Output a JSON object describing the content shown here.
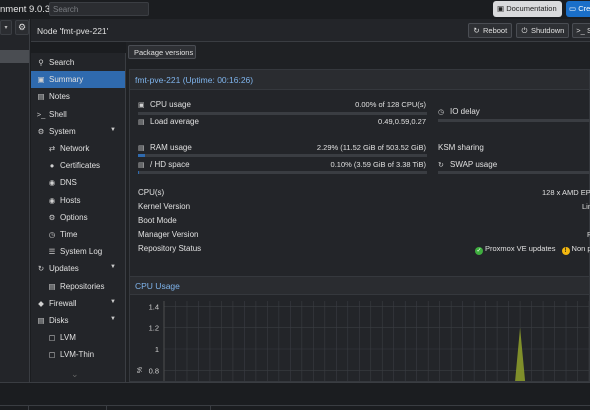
{
  "topbar": {
    "title_fragment": "nment 9.0.3",
    "search_placeholder": "Search",
    "documentation_label": "Documentation",
    "create_label": "Cre"
  },
  "tree": {
    "view_selector_icon": "chevron-down-icon",
    "gear_icon": "gear-icon"
  },
  "node_bar": {
    "title": "Node 'fmt-pve-221'",
    "reboot_label": "Reboot",
    "shutdown_label": "Shutdown",
    "shell_label": "S"
  },
  "nav": {
    "items": [
      {
        "label": "Search",
        "icon": "search-icon"
      },
      {
        "label": "Summary",
        "icon": "book-icon",
        "active": true
      },
      {
        "label": "Notes",
        "icon": "notes-icon"
      },
      {
        "label": "Shell",
        "icon": "terminal-icon"
      },
      {
        "label": "System",
        "icon": "gear-icon",
        "expandable": true
      },
      {
        "label": "Network",
        "icon": "network-icon"
      },
      {
        "label": "Certificates",
        "icon": "certificate-icon"
      },
      {
        "label": "DNS",
        "icon": "globe-icon"
      },
      {
        "label": "Hosts",
        "icon": "globe-icon"
      },
      {
        "label": "Options",
        "icon": "gear-icon"
      },
      {
        "label": "Time",
        "icon": "clock-icon"
      },
      {
        "label": "System Log",
        "icon": "list-icon"
      },
      {
        "label": "Updates",
        "icon": "refresh-icon",
        "expandable": true
      },
      {
        "label": "Repositories",
        "icon": "files-icon"
      },
      {
        "label": "Firewall",
        "icon": "shield-icon",
        "expandable": true
      },
      {
        "label": "Disks",
        "icon": "hdd-icon",
        "expandable": true
      },
      {
        "label": "LVM",
        "icon": "square-icon"
      },
      {
        "label": "LVM-Thin",
        "icon": "square-icon"
      }
    ]
  },
  "content": {
    "package_versions_label": "Package versions",
    "summary_title": "fmt-pve-221 (Uptime: 00:16:26)",
    "stats": {
      "cpu_usage": {
        "label": "CPU usage",
        "value": "0.00% of 128 CPU(s)",
        "fraction": 0.0
      },
      "io_delay": {
        "label": "IO delay"
      },
      "load_average": {
        "label": "Load average",
        "value": "0.49,0.59,0.27"
      },
      "ram_usage": {
        "label": "RAM usage",
        "value": "2.29% (11.52 GiB of 503.52 GiB)",
        "fraction": 0.0229
      },
      "ksm_sharing": {
        "label": "KSM sharing"
      },
      "hd_space": {
        "label": "/ HD space",
        "value": "0.10% (3.59 GiB of 3.38 TiB)",
        "fraction": 0.001
      },
      "swap_usage": {
        "label": "SWAP usage"
      }
    },
    "details": [
      {
        "key": "CPU(s)",
        "value": "128 x AMD EP"
      },
      {
        "key": "Kernel Version",
        "value": "Lin"
      },
      {
        "key": "Boot Mode",
        "value": ""
      },
      {
        "key": "Manager Version",
        "value": "P"
      },
      {
        "key": "Repository Status",
        "value": ""
      }
    ],
    "repo_status": {
      "ok_text": "Proxmox VE updates",
      "warn_text": "Non p"
    },
    "cpu_panel_title": "CPU Usage"
  },
  "chart_data": {
    "type": "area",
    "title": "CPU Usage",
    "ylabel": "%",
    "y_ticks": [
      "1.4",
      "1.2",
      "1",
      "0.8"
    ],
    "ylim": [
      0.7,
      1.45
    ],
    "series": [
      {
        "values": [
          0,
          0,
          0,
          0,
          0,
          0,
          0,
          0,
          0,
          0,
          0,
          0,
          0,
          0,
          0,
          0,
          0,
          0,
          0,
          0,
          0,
          0,
          0,
          0,
          0,
          0,
          0,
          0,
          0,
          0,
          0,
          1.2,
          0,
          0,
          0,
          0,
          0,
          0
        ],
        "color": "#8a9a2a"
      }
    ]
  }
}
